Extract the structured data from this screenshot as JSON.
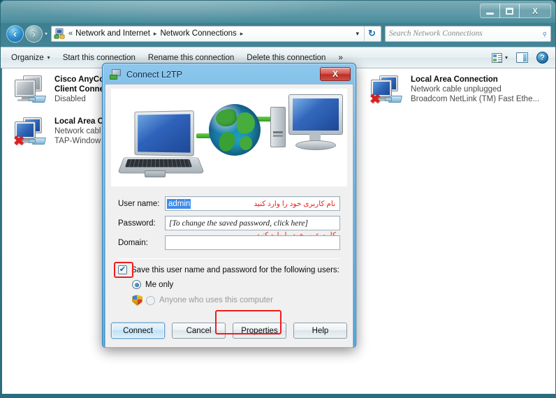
{
  "window": {
    "controls": {
      "minimize": "–",
      "maximize": "□",
      "close": "X"
    }
  },
  "address_bar": {
    "back_icon": "back-arrow",
    "forward_icon": "forward-arrow",
    "history_caret": "▾",
    "location_icon": "network-folder-icon",
    "chevrons": "«",
    "crumbs": [
      "Network and Internet",
      "Network Connections"
    ],
    "crumb_arrow": "▸",
    "dropdown_caret": "▾",
    "refresh_label": "↻",
    "search_placeholder": "Search Network Connections",
    "search_value": "",
    "search_icon": "magnifier-icon"
  },
  "toolbar": {
    "organize": "Organize",
    "organize_caret": "▾",
    "start_connection": "Start this connection",
    "rename_connection": "Rename this connection",
    "delete_connection": "Delete this connection",
    "overflow": "»",
    "views_icon": "views-icon",
    "views_caret": "▾",
    "preview_pane_icon": "preview-pane-icon",
    "help_icon": "help-icon",
    "help_glyph": "?"
  },
  "connections": [
    {
      "name": "Cisco AnyCo",
      "line2": "Client Conne",
      "line3": "Disabled",
      "screen": "gray",
      "error": false
    },
    {
      "name": "Local Area Co",
      "line2": "Network cabl",
      "line3": "TAP-Window",
      "screen": "blue",
      "error": true
    },
    {
      "name": "Local Area Connection",
      "line2": "Network cable unplugged",
      "line3": "Broadcom NetLink (TM) Fast Ethe...",
      "screen": "blue",
      "error": true
    }
  ],
  "list_overflow_marker": "...",
  "dialog": {
    "title": "Connect L2TP",
    "title_icon": "connection-icon",
    "close_label": "X",
    "illustration": {
      "laptop": "laptop-icon",
      "globe": "globe-icon",
      "desktop": "desktop-computer-icon",
      "cable": "green-network-cable"
    },
    "fields": {
      "username_label": "User name:",
      "username_value": "admin",
      "username_note_fa": "نام کاربری خود را وارد کنید",
      "password_label": "Password:",
      "password_value": "[To change the saved password, click here]",
      "password_note_fa": "کلمه عبور خود را وارد کنید",
      "domain_label": "Domain:",
      "domain_value": ""
    },
    "save_credentials": {
      "checked": true,
      "check_glyph": "✔",
      "label": "Save this user name and password for the following users:",
      "label_accesskey": "S",
      "label_rest": "ave this user name and password for the following users:"
    },
    "radios": [
      {
        "label": "Me only",
        "checked": true,
        "disabled": false
      },
      {
        "label": "Anyone who uses this computer",
        "checked": false,
        "disabled": true,
        "icon": "uac-shield-icon"
      }
    ],
    "buttons": [
      {
        "label": "Connect",
        "default": true,
        "highlighted": true
      },
      {
        "label": "Cancel",
        "default": false,
        "highlighted": false
      },
      {
        "label": "Properties",
        "default": false,
        "highlighted": false
      },
      {
        "label": "Help",
        "default": false,
        "highlighted": false
      }
    ]
  },
  "colors": {
    "highlight_red": "#f01c1c",
    "note_red": "#e82020",
    "selection_blue": "#3d8bea",
    "frame_teal": "#3d8496",
    "dialog_blue": "#64b0e2"
  }
}
